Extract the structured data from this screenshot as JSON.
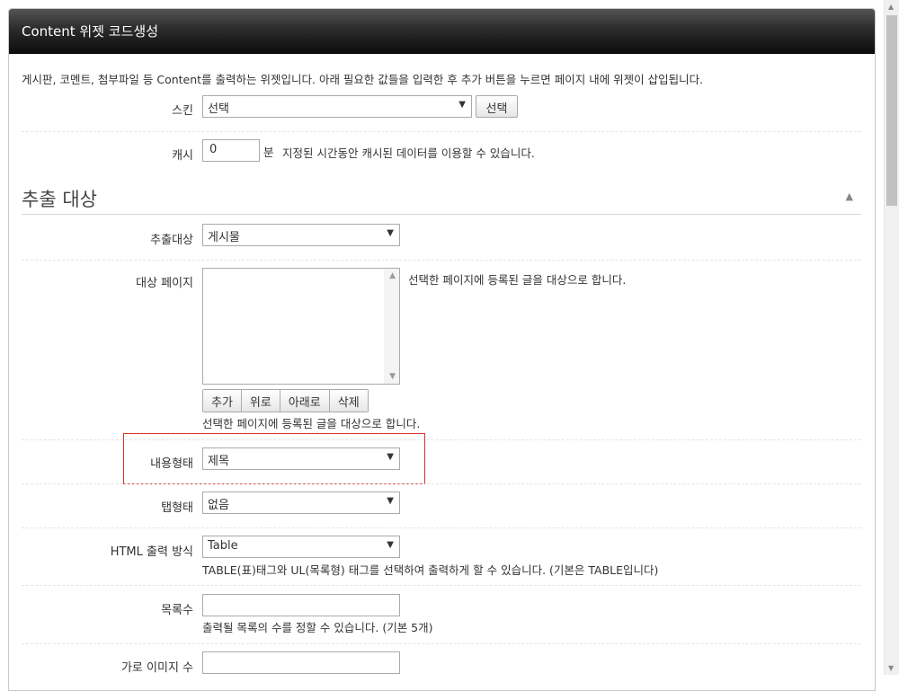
{
  "window": {
    "title": "Content 위젯 코드생성"
  },
  "intro": "게시판, 코멘트, 첨부파일 등 Content를 출력하는 위젯입니다. 아래 필요한 값들을 입력한 후 추가 버튼을 누르면 페이지 내에 위젯이 삽입됩니다.",
  "skin": {
    "label": "스킨",
    "value": "선택",
    "button": "선택"
  },
  "cache": {
    "label": "캐시",
    "value": "0",
    "unit": "분",
    "help": "지정된 시간동안 캐시된 데이터를 이용할 수 있습니다."
  },
  "section": {
    "title": "추출 대상",
    "collapse_icon": "chevron-up-icon"
  },
  "target": {
    "label": "추출대상",
    "value": "게시물"
  },
  "target_page": {
    "label": "대상 페이지",
    "help_right": "선택한 페이지에 등록된 글을 대상으로 합니다.",
    "buttons": [
      "추가",
      "위로",
      "아래로",
      "삭제"
    ],
    "help_below": "선택한 페이지에 등록된 글을 대상으로 합니다."
  },
  "content_type": {
    "label": "내용형태",
    "value": "제목"
  },
  "tab_type": {
    "label": "탭형태",
    "value": "없음"
  },
  "html_output": {
    "label": "HTML 출력 방식",
    "value": "Table",
    "help": "TABLE(표)태그와 UL(목록형) 태그를 선택하여 출력하게 할 수 있습니다. (기본은 TABLE입니다)"
  },
  "list_count": {
    "label": "목록수",
    "value": "",
    "help": "출력될 목록의 수를 정할 수 있습니다. (기본 5개)"
  },
  "cols": {
    "label": "가로 이미지 수",
    "value": ""
  },
  "colors": {
    "highlight": "#d9312b"
  }
}
